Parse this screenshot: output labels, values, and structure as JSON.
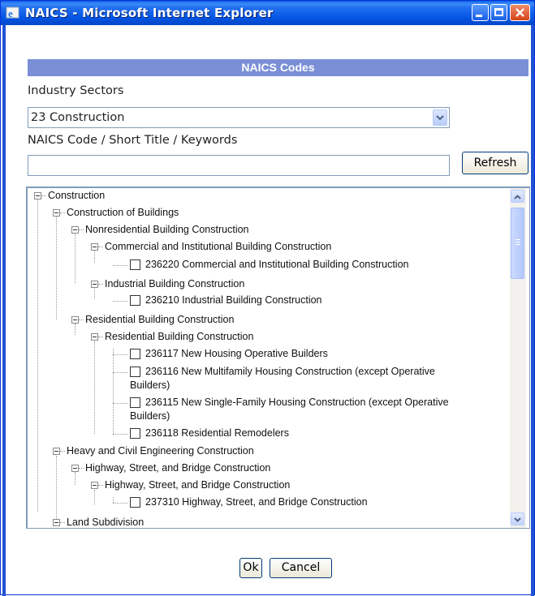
{
  "window": {
    "title": "NAICS - Microsoft Internet Explorer"
  },
  "header": {
    "title": "NAICS Codes"
  },
  "filters": {
    "sectors_label": "Industry Sectors",
    "sector_selected": "23 Construction",
    "keyword_label": "NAICS Code / Short Title / Keywords",
    "keyword_value": "",
    "refresh_label": "Refresh"
  },
  "tree": {
    "nodes": [
      {
        "text": "Construction"
      },
      {
        "text": "Construction of Buildings"
      },
      {
        "text": "Nonresidential Building Construction"
      },
      {
        "text": "Commercial and Institutional Building Construction"
      },
      {
        "text": "236220 Commercial and Institutional Building Construction"
      },
      {
        "text": "Industrial Building Construction"
      },
      {
        "text": "236210 Industrial Building Construction"
      },
      {
        "text": "Residential Building Construction"
      },
      {
        "text": "Residential Building Construction"
      },
      {
        "text": "236117 New Housing Operative Builders"
      },
      {
        "text": "236116 New Multifamily Housing Construction (except Operative"
      },
      {
        "text": "Builders)"
      },
      {
        "text": "236115 New Single-Family Housing Construction (except Operative"
      },
      {
        "text": "Builders)"
      },
      {
        "text": "236118 Residential Remodelers"
      },
      {
        "text": "Heavy and Civil Engineering Construction"
      },
      {
        "text": "Highway, Street, and Bridge Construction"
      },
      {
        "text": "Highway, Street, and Bridge Construction"
      },
      {
        "text": "237310 Highway, Street, and Bridge Construction"
      },
      {
        "text": "Land Subdivision"
      }
    ]
  },
  "footer": {
    "ok_label": "Ok",
    "cancel_label": "Cancel"
  }
}
